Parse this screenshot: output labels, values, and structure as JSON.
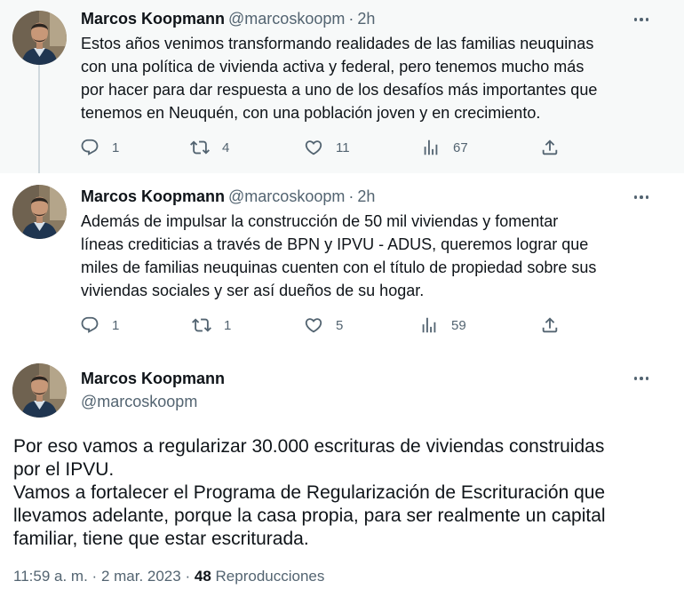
{
  "tweets": [
    {
      "name": "Marcos Koopmann",
      "handle": "@marcoskoopm",
      "separator": "·",
      "time": "2h",
      "text": "Estos años venimos transformando realidades de las familias neuquinas\ncon una política de vivienda activa y federal, pero tenemos mucho más\npor hacer para dar respuesta a uno de los desafíos más importantes que\ntenemos en Neuquén, con una población joven y en crecimiento.",
      "replies": "1",
      "retweets": "4",
      "likes": "11",
      "views": "67"
    },
    {
      "name": "Marcos Koopmann",
      "handle": "@marcoskoopm",
      "separator": "·",
      "time": "2h",
      "text": "Además de impulsar la construcción de 50 mil viviendas y fomentar\nlíneas crediticias a través de BPN y IPVU - ADUS, queremos lograr que\nmiles de familias neuquinas cuenten con el título de propiedad sobre sus\nviviendas sociales y ser así dueños de su hogar.",
      "replies": "1",
      "retweets": "1",
      "likes": "5",
      "views": "59"
    }
  ],
  "main_tweet": {
    "name": "Marcos Koopmann",
    "handle": "@marcoskoopm",
    "text": "Por eso vamos a regularizar 30.000 escrituras de viviendas construidas\npor el IPVU.\nVamos a fortalecer el Programa de Regularización de Escrituración que\nllevamos adelante, porque la casa propia, para ser realmente un capital\nfamiliar, tiene que estar escriturada.",
    "time": "11:59 a. m.",
    "separator": "·",
    "date": "2 mar. 2023",
    "views_count": "48",
    "views_label": "Reproducciones"
  },
  "icons": {
    "reply": "reply-icon",
    "retweet": "retweet-icon",
    "like": "heart-icon",
    "views": "views-chart-icon",
    "share": "share-icon",
    "more": "more-icon"
  },
  "colors": {
    "text": "#0f1419",
    "secondary": "#536471",
    "thread_line": "#cfd9de",
    "highlight_bg": "#f7f9f9"
  }
}
